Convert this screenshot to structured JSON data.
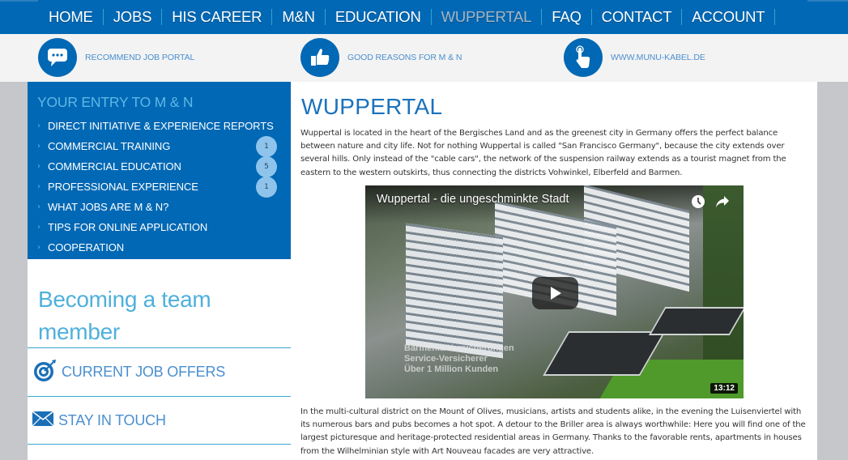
{
  "nav": {
    "items": [
      {
        "label": "HOME",
        "active": false
      },
      {
        "label": "JOBS",
        "active": false
      },
      {
        "label": "HIS CAREER",
        "active": false
      },
      {
        "label": "M&N",
        "active": false
      },
      {
        "label": "EDUCATION",
        "active": false
      },
      {
        "label": "WUPPERTAL",
        "active": true
      },
      {
        "label": "FAQ",
        "active": false
      },
      {
        "label": "CONTACT",
        "active": false
      },
      {
        "label": "ACCOUNT",
        "active": false
      }
    ]
  },
  "quicklinks": [
    {
      "label": "RECOMMEND JOB PORTAL",
      "icon": "chat-bubble-icon"
    },
    {
      "label": "GOOD REASONS FOR M & N",
      "icon": "thumbs-up-icon"
    },
    {
      "label": "WWW.MUNU-KABEL.DE",
      "icon": "pointing-hand-icon"
    }
  ],
  "sidebar": {
    "title": "YOUR ENTRY TO M & N",
    "items": [
      {
        "label": "DIRECT INITIATIVE & EXPERIENCE REPORTS",
        "badge": null
      },
      {
        "label": "COMMERCIAL TRAINING",
        "badge": "1"
      },
      {
        "label": "COMMERCIAL EDUCATION",
        "badge": "5"
      },
      {
        "label": "PROFESSIONAL EXPERIENCE",
        "badge": "1"
      },
      {
        "label": "WHAT JOBS ARE M & N?",
        "badge": null
      },
      {
        "label": "TIPS FOR ONLINE APPLICATION",
        "badge": null
      },
      {
        "label": "COOPERATION",
        "badge": null
      }
    ],
    "team_title": "Becoming a team member",
    "links": [
      {
        "label": "CURRENT JOB OFFERS",
        "icon": "target-icon"
      },
      {
        "label": "STAY IN TOUCH",
        "icon": "envelope-icon"
      }
    ]
  },
  "main": {
    "title": "WUPPERTAL",
    "paragraph1": "Wuppertal is located in the heart of the Bergisches Land and as the greenest city in Germany offers the perfect balance between nature and city life. Not for nothing Wuppertal is called \"San Francisco Germany\", because the city extends over several hills. Only instead of the \"cable cars\", the network of the suspension railway extends as a tourist magnet from the eastern to the western outskirts, thus connecting the districts Vohwinkel, Elberfeld and Barmen.",
    "video": {
      "title": "Wuppertal - die ungeschminkte Stadt",
      "overlay_lines": [
        "Barmenia Versicherungen",
        "Service-Versicherer",
        "Über 1 Million Kunden"
      ],
      "duration": "13:12"
    },
    "paragraph2": "In the multi-cultural district on the Mount of Olives, musicians, artists and students alike, in the evening the Luisenviertel with its numerous bars and pubs becomes a hot spot. A detour to the Briller area is always worthwhile: Here you will find one of the largest picturesque and heritage-protected residential areas in Germany. Thanks to the favorable rents, apartments in houses from the Wilhelminian style with Art Nouveau facades are very attractive."
  },
  "colors": {
    "brand_blue": "#0068b4",
    "light_blue": "#4fb0db",
    "badge": "#8ec4ec",
    "nav_active": "#a9b6c3"
  }
}
